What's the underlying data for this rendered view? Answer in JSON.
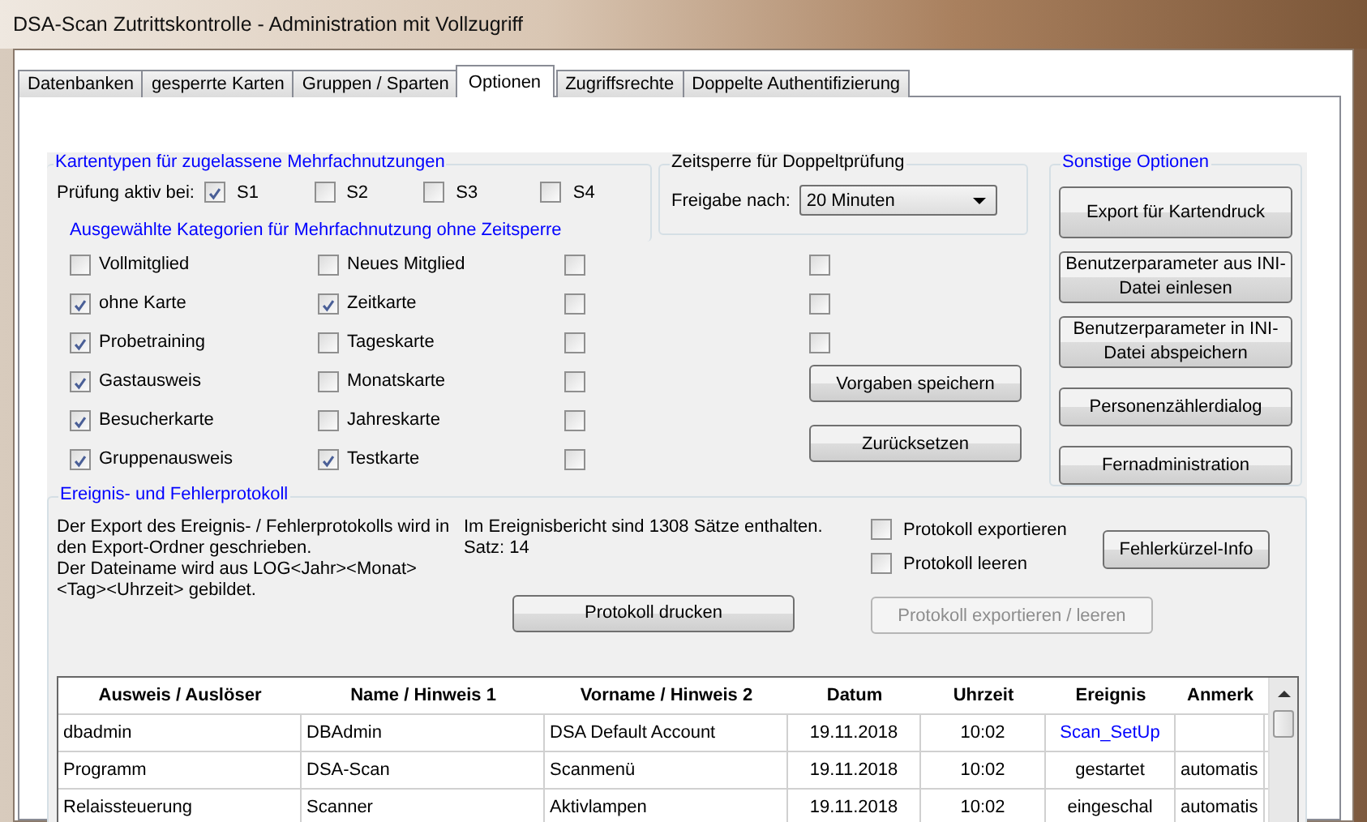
{
  "window": {
    "title": "DSA-Scan Zutrittskontrolle - Administration mit Vollzugriff"
  },
  "tabs": [
    {
      "label": "Datenbanken",
      "selected": false
    },
    {
      "label": "gesperrte Karten",
      "selected": false
    },
    {
      "label": "Gruppen / Sparten",
      "selected": false
    },
    {
      "label": "Optionen",
      "selected": true
    },
    {
      "label": "Zugriffsrechte",
      "selected": false
    },
    {
      "label": "Doppelte Authentifizierung",
      "selected": false
    }
  ],
  "card_types": {
    "title": "Kartentypen für zugelassene Mehrfachnutzungen",
    "check_label": "Prüfung aktiv bei:",
    "slots": [
      {
        "label": "S1",
        "checked": true
      },
      {
        "label": "S2",
        "checked": false
      },
      {
        "label": "S3",
        "checked": false
      },
      {
        "label": "S4",
        "checked": false
      }
    ],
    "subtitle": "Ausgewählte Kategorien für Mehrfachnutzung ohne Zeitsperre"
  },
  "categories": [
    [
      {
        "label": "Vollmitglied",
        "checked": false
      },
      {
        "label": "ohne Karte",
        "checked": true
      },
      {
        "label": "Probetraining",
        "checked": true
      },
      {
        "label": "Gastausweis",
        "checked": true
      },
      {
        "label": "Besucherkarte",
        "checked": true
      },
      {
        "label": "Gruppenausweis",
        "checked": true
      }
    ],
    [
      {
        "label": "Neues Mitglied",
        "checked": false
      },
      {
        "label": "Zeitkarte",
        "checked": true
      },
      {
        "label": "Tageskarte",
        "checked": false
      },
      {
        "label": "Monatskarte",
        "checked": false
      },
      {
        "label": "Jahreskarte",
        "checked": false
      },
      {
        "label": "Testkarte",
        "checked": true
      }
    ],
    [
      {
        "checked": false
      },
      {
        "checked": false
      },
      {
        "checked": false
      },
      {
        "checked": false
      },
      {
        "checked": false
      },
      {
        "checked": false
      }
    ],
    [
      {
        "checked": false
      },
      {
        "checked": false
      },
      {
        "checked": false
      }
    ]
  ],
  "lockout": {
    "title": "Zeitsperre für Doppeltprüfung",
    "release_label": "Freigabe nach:",
    "release_value": "20 Minuten"
  },
  "default_buttons": [
    "Vorgaben speichern",
    "Zurücksetzen"
  ],
  "other_options": {
    "title": "Sonstige Optionen",
    "buttons": [
      {
        "label": "Export für Kartendruck",
        "kind": "large"
      },
      {
        "label": "Benutzerparameter  aus INI-Datei einlesen",
        "kind": "large"
      },
      {
        "label": "Benutzerparameter in INI-Datei abspeichern",
        "kind": "large"
      },
      {
        "label": "Personenzählerdialog",
        "kind": "small"
      },
      {
        "label": "Fernadministration",
        "kind": "small"
      }
    ]
  },
  "log": {
    "title": "Ereignis- und Fehlerprotokoll",
    "description": [
      "Der Export des Ereignis- / Fehlerprotokolls wird in den Export-Ordner geschrieben.",
      "Der Dateiname wird aus LOG<Jahr><Monat><Tag><Uhrzeit> gebildet."
    ],
    "record_info": "Im Ereignisbericht sind 1308 Sätze enthalten.",
    "record_index": "Satz: 14",
    "options": [
      {
        "label": "Protokoll exportieren",
        "checked": false
      },
      {
        "label": "Protokoll leeren",
        "checked": false
      }
    ],
    "info_button": {
      "label": "Fehlerkürzel-Info"
    },
    "print_button": {
      "label": "Protokoll drucken"
    },
    "export_button": {
      "label": "Protokoll exportieren / leeren",
      "disabled": true
    }
  },
  "table": {
    "columns": [
      "Ausweis / Auslöser",
      "Name / Hinweis 1",
      "Vorname / Hinweis 2",
      "Datum",
      "Uhrzeit",
      "Ereignis",
      "Anmerk"
    ],
    "rows": [
      {
        "cells": [
          "dbadmin",
          "DBAdmin",
          "DSA Default Account",
          "19.11.2018",
          "10:02",
          "Scan_SetUp",
          ""
        ],
        "event_highlighted": true
      },
      {
        "cells": [
          "Programm",
          "DSA-Scan",
          "Scanmenü",
          "19.11.2018",
          "10:02",
          "gestartet",
          "automatis"
        ],
        "event_highlighted": false
      },
      {
        "cells": [
          "Relaissteuerung",
          "Scanner",
          "Aktivlampen",
          "19.11.2018",
          "10:02",
          "eingeschal",
          "automatis"
        ],
        "event_highlighted": false
      }
    ]
  }
}
